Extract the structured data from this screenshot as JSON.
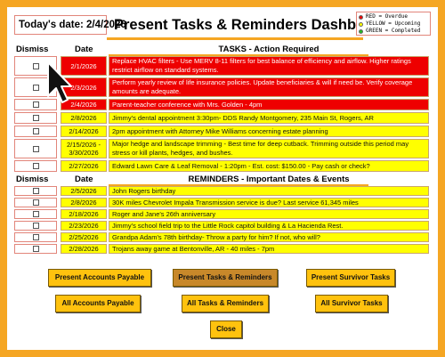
{
  "header": {
    "date_label": "Today's date: 2/4/2026",
    "title": "Present Tasks & Reminders Dashboard"
  },
  "legend": [
    {
      "label": "RED = Overdue",
      "color": "#ee0000"
    },
    {
      "label": "YELLOW = Upcoming",
      "color": "#ffff00"
    },
    {
      "label": "GREEN = Completed",
      "color": "#22bb22"
    }
  ],
  "tasks": {
    "col_dismiss": "Dismiss",
    "col_date": "Date",
    "title": "TASKS - Action Required",
    "rows": [
      {
        "date": "2/1/2026",
        "text": "Replace HVAC filters - Use MERV 8-11 filters for best balance of efficiency and airflow. Higher ratings restrict airflow on standard systems.",
        "status": "red"
      },
      {
        "date": "2/3/2026",
        "text": "Perform yearly review of life insurance policies. Update beneficiaries & will if need be. Verify coverage amounts are adequate.",
        "status": "red"
      },
      {
        "date": "2/4/2026",
        "text": "Parent-teacher conference with Mrs. Golden - 4pm",
        "status": "red"
      },
      {
        "date": "2/8/2026",
        "text": "Jimmy's dental appointment 3:30pm- DDS Randy Montgomery, 235 Main St, Rogers, AR",
        "status": "yellow"
      },
      {
        "date": "2/14/2026",
        "text": "2pm appointment with Attorney Mike Williams concerning estate planning",
        "status": "yellow"
      },
      {
        "date": "2/15/2026 - 3/30/2026",
        "text": "Major hedge and landscape trimming - Best time for deep cutback. Trimming outside this period may stress or kill plants, hedges, and bushes.",
        "status": "yellow"
      },
      {
        "date": "2/27/2026",
        "text": "Edward Lawn Care & Leaf Removal - 1:20pm - Est. cost: $150.00 - Pay cash or check?",
        "status": "yellow"
      }
    ]
  },
  "reminders": {
    "col_dismiss": "Dismiss",
    "col_date": "Date",
    "title": "REMINDERS - Important Dates & Events",
    "rows": [
      {
        "date": "2/5/2026",
        "text": "John Rogers birthday"
      },
      {
        "date": "2/8/2026",
        "text": "30K miles Chevrolet Impala Transmission service is due? Last service 61,345 miles"
      },
      {
        "date": "2/18/2026",
        "text": "Roger and Jane's 26th anniversary"
      },
      {
        "date": "2/23/2026",
        "text": "Jimmy's school field trip to the Little Rock capitol building & La Hacienda Rest."
      },
      {
        "date": "2/25/2026",
        "text": "Grandpa Adam's 78th birthday- Throw a party for him? If not, who will?"
      },
      {
        "date": "2/28/2026",
        "text": "Trojans away game at Bentonville, AR - 40 miles - 7pm"
      }
    ]
  },
  "buttons": {
    "present_ap": "Present Accounts Payable",
    "present_tasks": "Present Tasks & Reminders",
    "present_survivor": "Present Survivor Tasks",
    "all_ap": "All Accounts Payable",
    "all_tasks": "All Tasks & Reminders",
    "all_survivor": "All Survivor Tasks",
    "close": "Close"
  }
}
